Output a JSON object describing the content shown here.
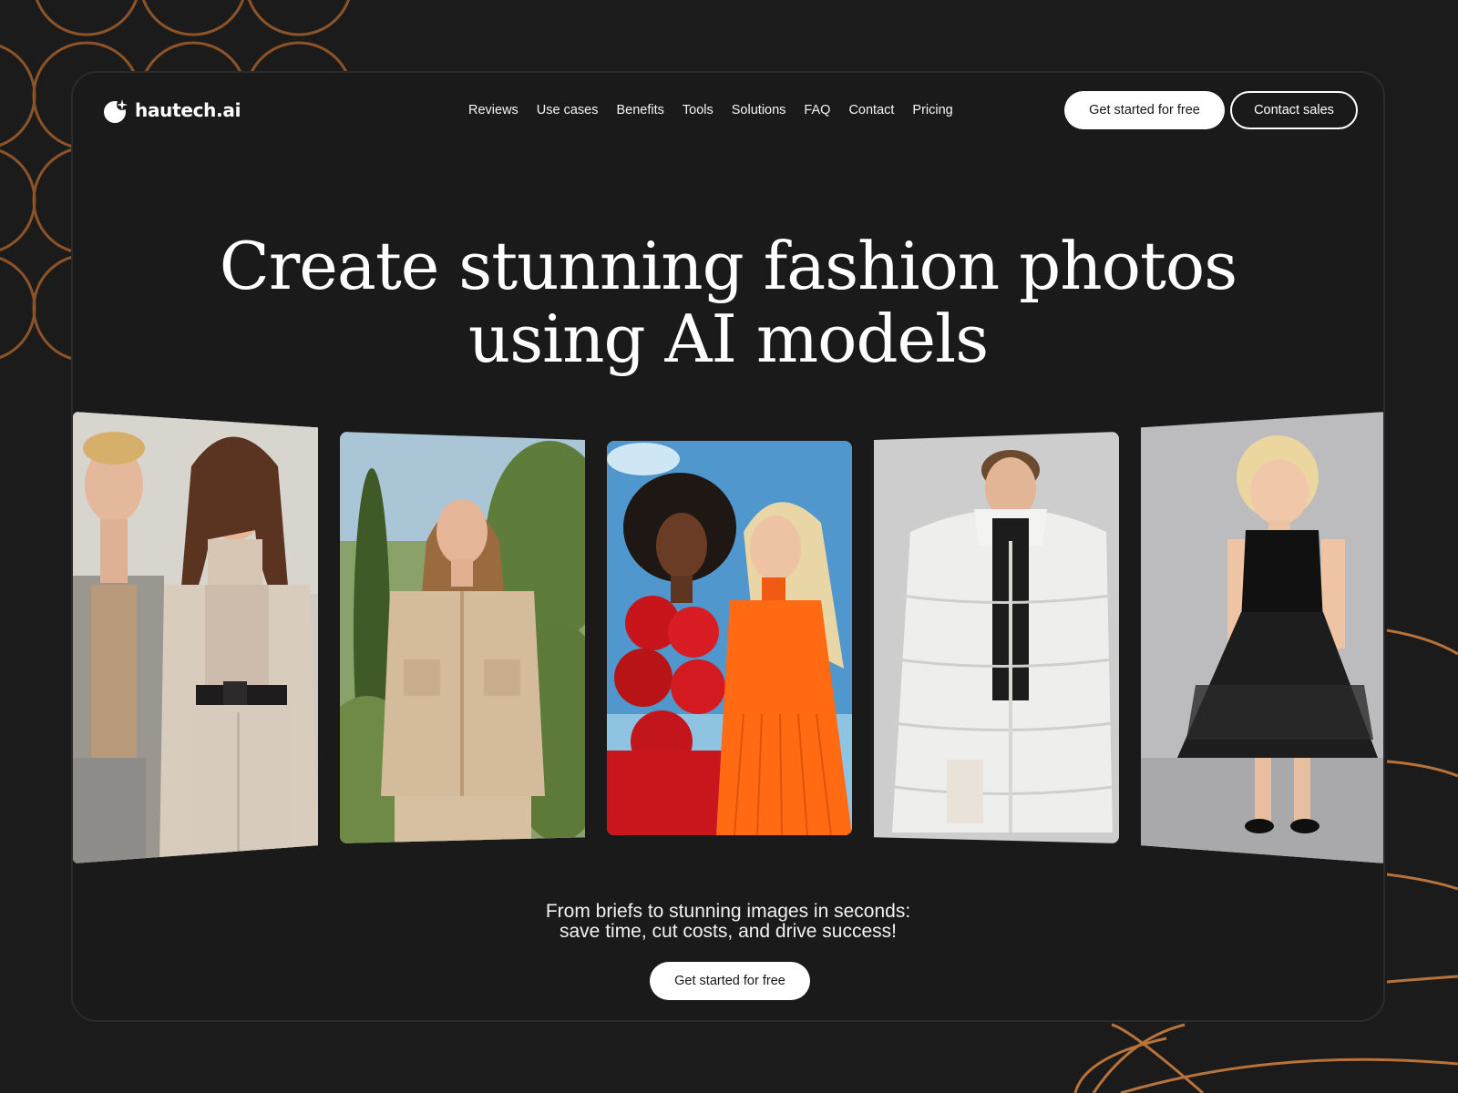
{
  "brand": {
    "name": "hautech.ai",
    "logo_icon": "sparkle-crescent-icon"
  },
  "nav": {
    "items": [
      {
        "label": "Reviews"
      },
      {
        "label": "Use cases"
      },
      {
        "label": "Benefits"
      },
      {
        "label": "Tools"
      },
      {
        "label": "Solutions"
      },
      {
        "label": "FAQ"
      },
      {
        "label": "Contact"
      },
      {
        "label": "Pricing"
      }
    ]
  },
  "header": {
    "primary_cta": "Get started for free",
    "secondary_cta": "Contact sales"
  },
  "hero": {
    "title_line1": "Create stunning fashion photos",
    "title_line2": "using AI models",
    "tagline_line1": "From briefs to stunning images in seconds:",
    "tagline_line2": "save time, cut costs, and drive success!",
    "cta": "Get started for free"
  },
  "gallery": [
    {
      "subject": "couple in neutral tailored outfits"
    },
    {
      "subject": "woman in beige utility shirt outdoors"
    },
    {
      "subject": "two women in red ruffle and orange pleated dresses"
    },
    {
      "subject": "man in white puffer coat"
    },
    {
      "subject": "girl in black tulle dress"
    }
  ],
  "colors": {
    "background": "#1b1b1b",
    "accent": "#b8733a",
    "button_bg": "#ffffff",
    "button_text": "#161616"
  }
}
